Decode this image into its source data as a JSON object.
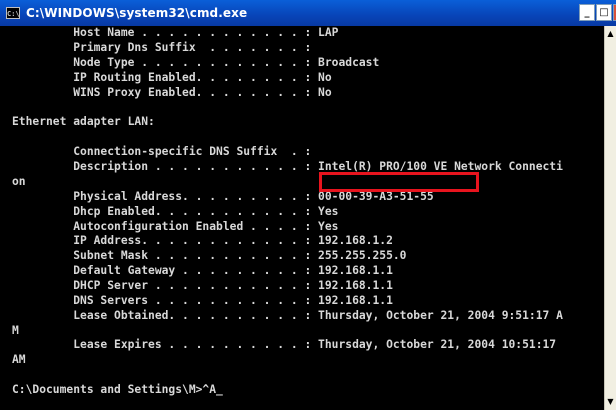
{
  "window": {
    "title": "C:\\WINDOWS\\system32\\cmd.exe",
    "icon_label": "C:\\",
    "minimize_label": "_",
    "maximize_label": "□",
    "close_label": "x"
  },
  "scrollbar": {
    "up_icon": "scroll-up-icon",
    "down_icon": "scroll-down-icon",
    "up_glyph": "▲",
    "down_glyph": "▼"
  },
  "console": {
    "lines": [
      "         Host Name . . . . . . . . . . . . : LAP",
      "         Primary Dns Suffix  . . . . . . . :",
      "         Node Type . . . . . . . . . . . . : Broadcast",
      "         IP Routing Enabled. . . . . . . . : No",
      "         WINS Proxy Enabled. . . . . . . . : No",
      "",
      "Ethernet adapter LAN:",
      "",
      "         Connection-specific DNS Suffix  . :",
      "         Description . . . . . . . . . . . : Intel(R) PRO/100 VE Network Connecti",
      "on",
      "         Physical Address. . . . . . . . . : 00-00-39-A3-51-55",
      "         Dhcp Enabled. . . . . . . . . . . : Yes",
      "         Autoconfiguration Enabled . . . . : Yes",
      "         IP Address. . . . . . . . . . . . : 192.168.1.2",
      "         Subnet Mask . . . . . . . . . . . : 255.255.255.0",
      "         Default Gateway . . . . . . . . . : 192.168.1.1",
      "         DHCP Server . . . . . . . . . . . : 192.168.1.1",
      "         DNS Servers . . . . . . . . . . . : 192.168.1.1",
      "         Lease Obtained. . . . . . . . . . : Thursday, October 21, 2004 9:51:17 A",
      "M",
      "         Lease Expires . . . . . . . . . . : Thursday, October 21, 2004 10:51:17",
      "AM",
      "",
      "C:\\Documents and Settings\\M>^A_"
    ]
  },
  "colors": {
    "console_background": "#000000",
    "console_text": "#d8d8d8",
    "highlight_border": "#e8141e",
    "titlebar": "#0844b8"
  }
}
